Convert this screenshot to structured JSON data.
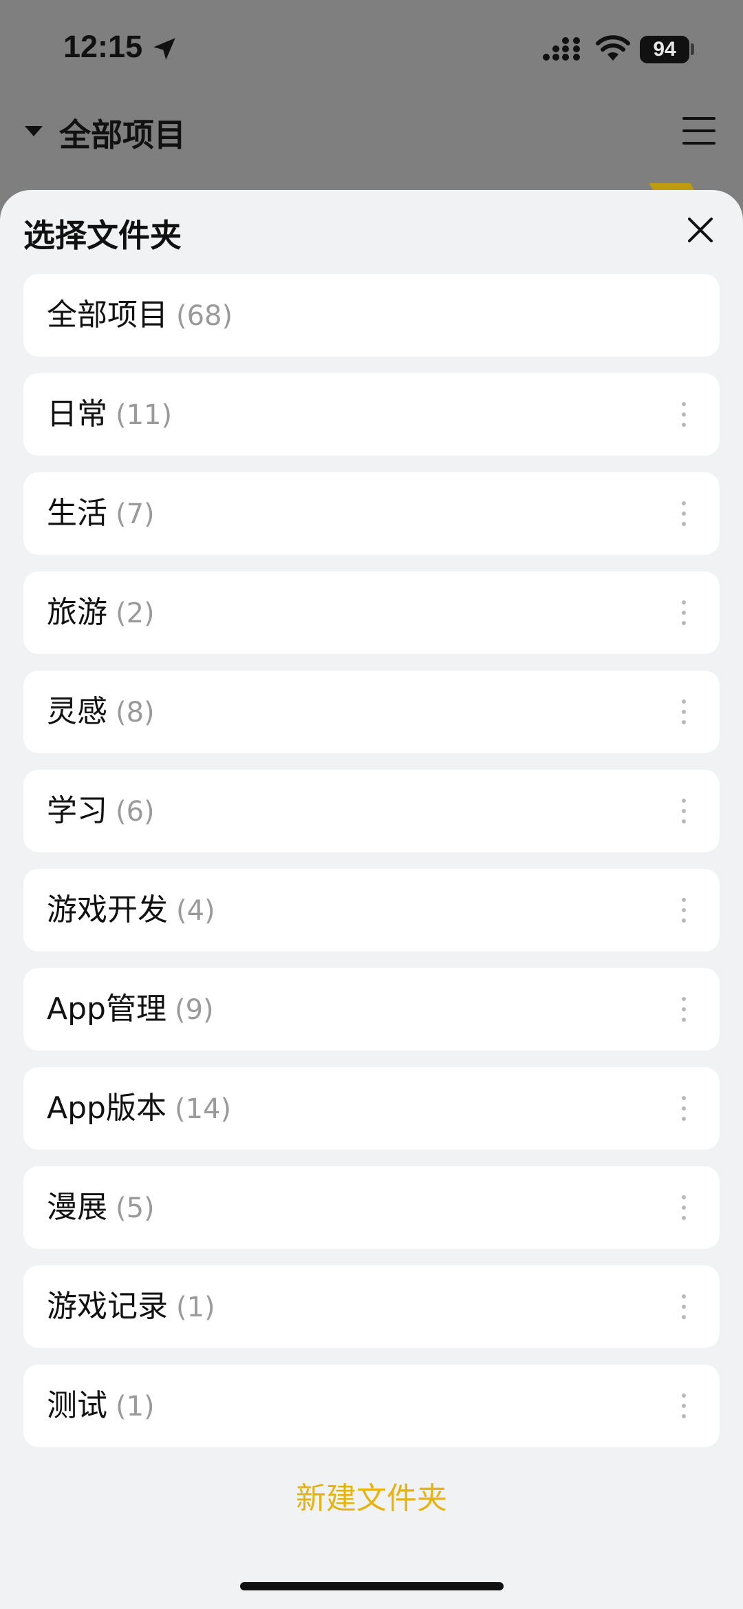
{
  "status_bar": {
    "time": "12:15",
    "battery": "94"
  },
  "header": {
    "title": "全部项目"
  },
  "sheet": {
    "title": "选择文件夹",
    "folders": [
      {
        "name": "全部项目",
        "count": "(68)"
      },
      {
        "name": "日常",
        "count": "(11)"
      },
      {
        "name": "生活",
        "count": "(7)"
      },
      {
        "name": "旅游",
        "count": "(2)"
      },
      {
        "name": "灵感",
        "count": "(8)"
      },
      {
        "name": "学习",
        "count": "(6)"
      },
      {
        "name": "游戏开发",
        "count": "(4)"
      },
      {
        "name": "App管理",
        "count": "(9)"
      },
      {
        "name": "App版本",
        "count": "(14)"
      },
      {
        "name": "漫展",
        "count": "(5)"
      },
      {
        "name": "游戏记录",
        "count": "(1)"
      },
      {
        "name": "测试",
        "count": "(1)"
      }
    ],
    "new_folder_label": "新建文件夹"
  },
  "colors": {
    "accent": "#e3b413",
    "sheet_bg": "#f1f2f4",
    "overlay": "#7f7f7f"
  }
}
